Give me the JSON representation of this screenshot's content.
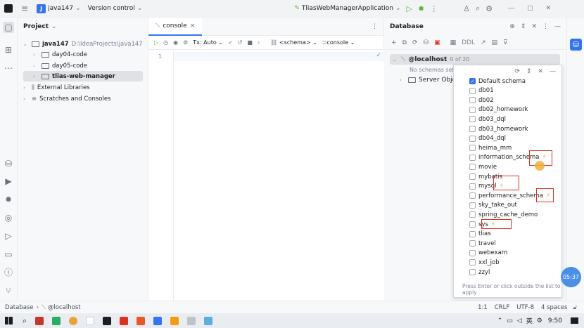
{
  "titlebar": {
    "project_badge": "J",
    "project_name": "java147",
    "version_control": "Version control",
    "run_config": "TliasWebManagerApplication",
    "icons": [
      "hamburger-menu-icon",
      "run-icon",
      "debug-icon",
      "more-icon",
      "add-user-icon",
      "search-icon",
      "settings-icon",
      "minimize-icon",
      "maximize-icon",
      "close-icon"
    ]
  },
  "project_panel": {
    "title": "Project",
    "root_name": "java147",
    "root_path": "D:\\IdeaProjects\\java147",
    "items": [
      {
        "label": "day04-code"
      },
      {
        "label": "day05-code"
      },
      {
        "label": "tlias-web-manager"
      }
    ],
    "external_libraries": "External Libraries",
    "scratches": "Scratches and Consoles"
  },
  "editor": {
    "tab_label": "console",
    "tx_mode": "Tx: Auto",
    "schema_selector": "<schema>",
    "console_selector": "console",
    "line_number": "1"
  },
  "database": {
    "title": "Database",
    "ddl_label": "DDL",
    "host": "@localhost",
    "host_count": "0 of 20",
    "no_schemas": "No schemas selec",
    "server_objects": "Server Obje"
  },
  "schema_popup": {
    "items": [
      {
        "label": "Default schema",
        "checked": true
      },
      {
        "label": "db01",
        "checked": false
      },
      {
        "label": "db02",
        "checked": false
      },
      {
        "label": "db02_homework",
        "checked": false
      },
      {
        "label": "db03_dql",
        "checked": false
      },
      {
        "label": "db03_homework",
        "checked": false
      },
      {
        "label": "db04_dql",
        "checked": false
      },
      {
        "label": "heima_mm",
        "checked": false
      },
      {
        "label": "information_schema",
        "checked": false,
        "system": true
      },
      {
        "label": "movie",
        "checked": false
      },
      {
        "label": "mybatis",
        "checked": false
      },
      {
        "label": "mysql",
        "checked": false,
        "system": true
      },
      {
        "label": "performance_schema",
        "checked": false,
        "system": true
      },
      {
        "label": "sky_take_out",
        "checked": false
      },
      {
        "label": "spring_cache_demo",
        "checked": false
      },
      {
        "label": "sys",
        "checked": false,
        "system": true
      },
      {
        "label": "tlias",
        "checked": false
      },
      {
        "label": "travel",
        "checked": false
      },
      {
        "label": "webexam",
        "checked": false
      },
      {
        "label": "xxl_job",
        "checked": false
      },
      {
        "label": "zzyl",
        "checked": false
      }
    ],
    "hint": "Press Enter or click outside the list to apply"
  },
  "status_bar": {
    "breadcrumb_db": "Database",
    "breadcrumb_host": "@localhost",
    "position": "1:1",
    "line_sep": "CRLF",
    "encoding": "UTF-8",
    "indent": "4 spaces"
  },
  "taskbar": {
    "ime": "英",
    "time": "9:50"
  },
  "recording_badge": "05:37",
  "colors": {
    "accent": "#3574f0",
    "bolt": "#e8a33d",
    "highlight": "#e0301e"
  }
}
